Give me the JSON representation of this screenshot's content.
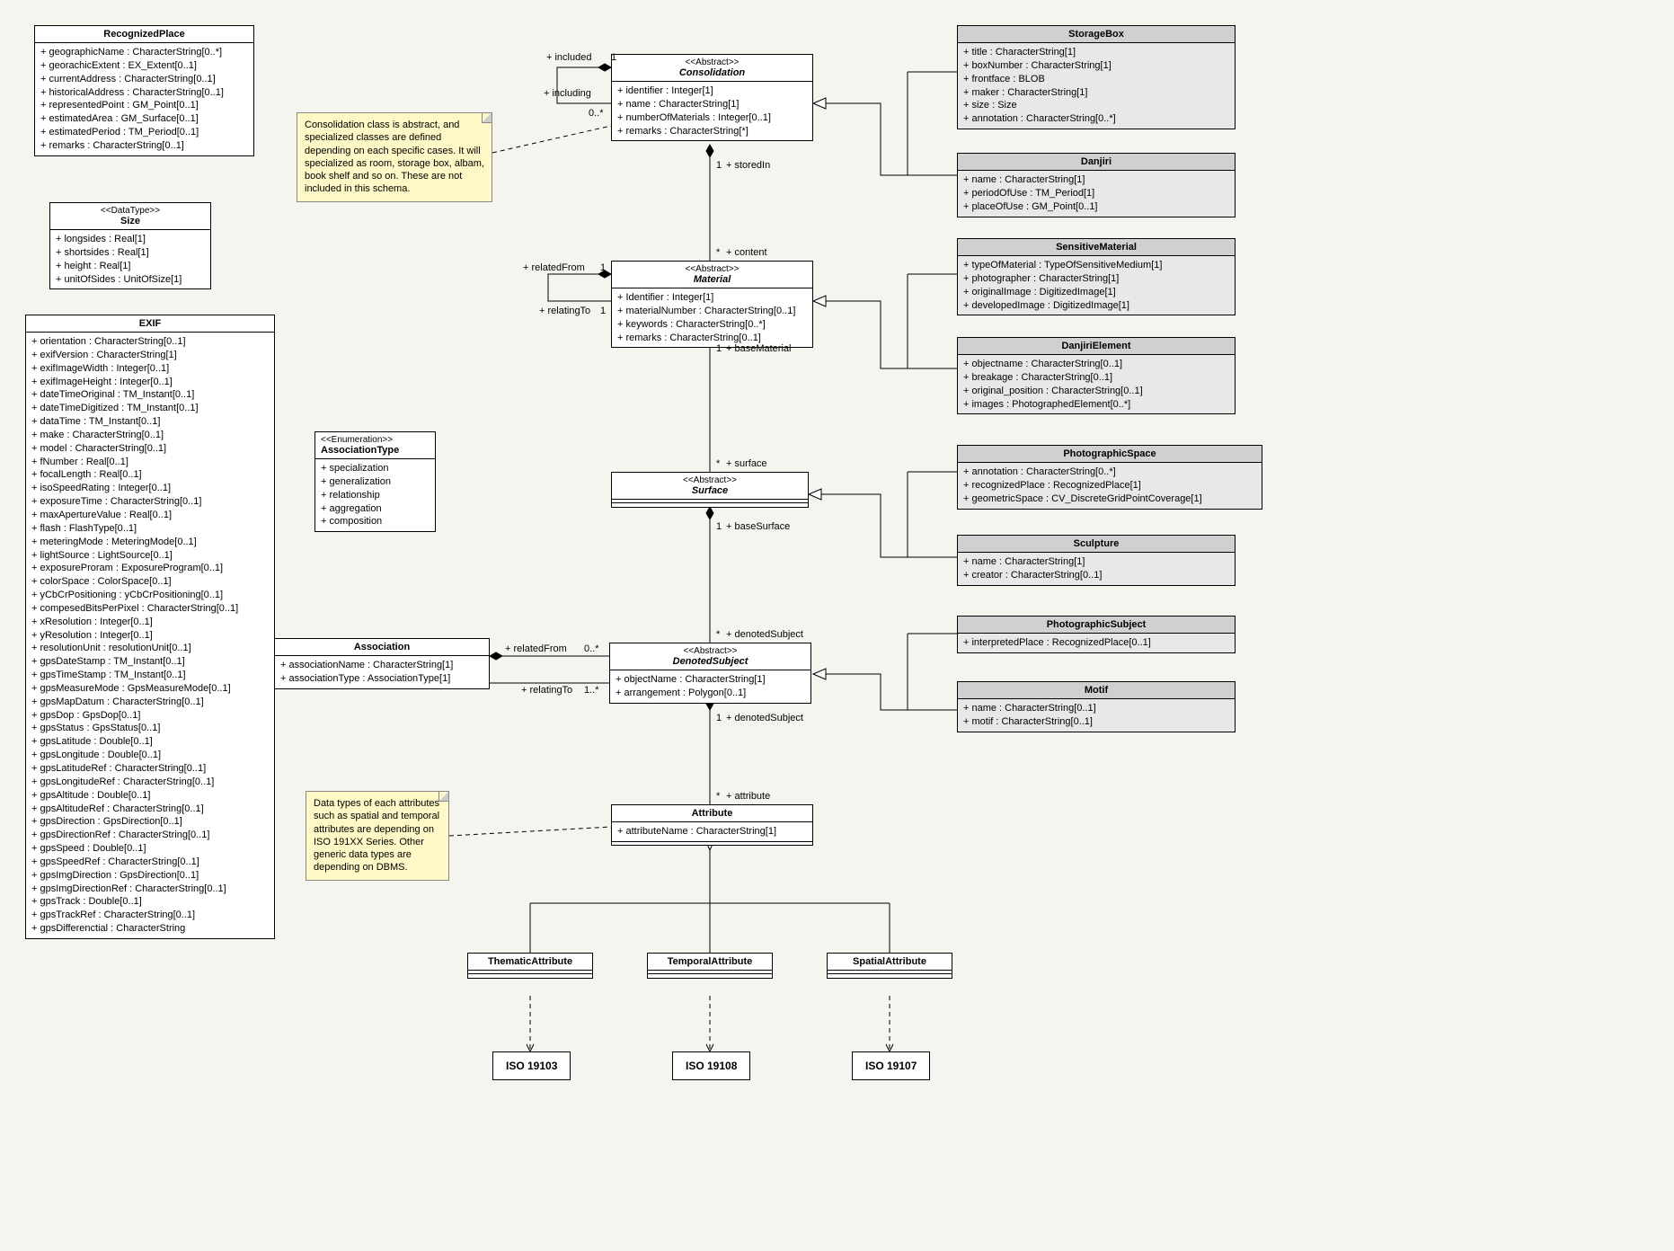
{
  "classes": {
    "RecognizedPlace": {
      "title": "RecognizedPlace",
      "attrs": [
        "+ geographicName : CharacterString[0..*]",
        "+ georachicExtent : EX_Extent[0..1]",
        "+ currentAddress : CharacterString[0..1]",
        "+ historicalAddress : CharacterString[0..1]",
        "+ representedPoint : GM_Point[0..1]",
        "+ estimatedArea : GM_Surface[0..1]",
        "+ estimatedPeriod : TM_Period[0..1]",
        "+ remarks : CharacterString[0..1]"
      ]
    },
    "Size": {
      "stereo": "<<DataType>>",
      "title": "Size",
      "attrs": [
        "+ longsides : Real[1]",
        "+ shortsides : Real[1]",
        "+ height : Real[1]",
        "+ unitOfSides : UnitOfSize[1]"
      ]
    },
    "EXIF": {
      "title": "EXIF",
      "attrs": [
        "+ orientation : CharacterString[0..1]",
        "+ exifVersion : CharacterString[1]",
        "+ exifImageWidth : Integer[0..1]",
        "+ exifImageHeight : Integer[0..1]",
        "+ dateTimeOriginal : TM_Instant[0..1]",
        "+ dateTimeDigitized : TM_Instant[0..1]",
        "+ dataTime : TM_Instant[0..1]",
        "+ make : CharacterString[0..1]",
        "+ model : CharacterString[0..1]",
        "+ fNumber : Real[0..1]",
        "+ focalLength : Real[0..1]",
        "+ isoSpeedRating : Integer[0..1]",
        "+ exposureTime : CharacterString[0..1]",
        "+ maxApertureValue : Real[0..1]",
        "+ flash : FlashType[0..1]",
        "+ meteringMode : MeteringMode[0..1]",
        "+ lightSource : LightSource[0..1]",
        "+ exposureProram : ExposureProgram[0..1]",
        "+ colorSpace : ColorSpace[0..1]",
        "+ yCbCrPositioning : yCbCrPositioning[0..1]",
        "+ compesedBitsPerPixel : CharacterString[0..1]",
        "+ xResolution : Integer[0..1]",
        "+ yResolution : Integer[0..1]",
        "+ resolutionUnit : resolutionUnit[0..1]",
        "+ gpsDateStamp : TM_Instant[0..1]",
        "+ gpsTimeStamp : TM_Instant[0..1]",
        "+ gpsMeasureMode : GpsMeasureMode[0..1]",
        "+ gpsMapDatum : CharacterString[0..1]",
        "+ gpsDop : GpsDop[0..1]",
        "+ gpsStatus : GpsStatus[0..1]",
        "+ gpsLatitude : Double[0..1]",
        "+ gpsLongitude : Double[0..1]",
        "+ gpsLatitudeRef : CharacterString[0..1]",
        "+ gpsLongitudeRef : CharacterString[0..1]",
        "+ gpsAltitude : Double[0..1]",
        "+ gpsAltitudeRef : CharacterString[0..1]",
        "+ gpsDirection : GpsDirection[0..1]",
        "+ gpsDirectionRef : CharacterString[0..1]",
        "+ gpsSpeed : Double[0..1]",
        "+ gpsSpeedRef : CharacterString[0..1]",
        "+ gpsImgDirection : GpsDirection[0..1]",
        "+ gpsImgDirectionRef : CharacterString[0..1]",
        "+ gpsTrack : Double[0..1]",
        "+ gpsTrackRef : CharacterString[0..1]",
        "+ gpsDifferenctial : CharacterString"
      ]
    },
    "Consolidation": {
      "stereo": "<<Abstract>>",
      "title": "Consolidation",
      "italic": true,
      "attrs": [
        "+ identifier : Integer[1]",
        "+ name : CharacterString[1]",
        "+ numberOfMaterials : Integer[0..1]",
        "+ remarks : CharacterString[*]"
      ]
    },
    "Material": {
      "stereo": "<<Abstract>>",
      "title": "Material",
      "italic": true,
      "attrs": [
        "+ Identifier : Integer[1]",
        "+ materialNumber : CharacterString[0..1]",
        "+ keywords : CharacterString[0..*]",
        "+ remarks : CharacterString[0..1]"
      ]
    },
    "AssociationType": {
      "stereo": "<<Enumeration>>",
      "title": "AssociationType",
      "attrs": [
        "+ specialization",
        "+ generalization",
        "+ relationship",
        "+ aggregation",
        "+ composition"
      ]
    },
    "Surface": {
      "stereo": "<<Abstract>>",
      "title": "Surface",
      "italic": true,
      "attrs": []
    },
    "Association": {
      "title": "Association",
      "attrs": [
        "+ associationName : CharacterString[1]",
        "+ associationType : AssociationType[1]"
      ]
    },
    "DenotedSubject": {
      "stereo": "<<Abstract>>",
      "title": "DenotedSubject",
      "italic": true,
      "attrs": [
        "+ objectName : CharacterString[1]",
        "+ arrangement : Polygon[0..1]"
      ]
    },
    "Attribute": {
      "title": "Attribute",
      "attrs": [
        "+ attributeName : CharacterString[1]"
      ]
    },
    "ThematicAttribute": {
      "title": "ThematicAttribute",
      "attrs": []
    },
    "TemporalAttribute": {
      "title": "TemporalAttribute",
      "attrs": []
    },
    "SpatialAttribute": {
      "title": "SpatialAttribute",
      "attrs": []
    },
    "StorageBox": {
      "title": "StorageBox",
      "attrs": [
        "+ title : CharacterString[1]",
        "+ boxNumber : CharacterString[1]",
        "+ frontface : BLOB",
        "+ maker : CharacterString[1]",
        "+ size : Size",
        "+ annotation : CharacterString[0..*]"
      ]
    },
    "Danjiri": {
      "title": "Danjiri",
      "attrs": [
        "+ name : CharacterString[1]",
        "+ periodOfUse : TM_Period[1]",
        "+ placeOfUse : GM_Point[0..1]"
      ]
    },
    "SensitiveMaterial": {
      "title": "SensitiveMaterial",
      "attrs": [
        "+ typeOfMaterial : TypeOfSensitiveMedium[1]",
        "+ photographer : CharacterString[1]",
        "+ originalImage : DigitizedImage[1]",
        "+ developedImage : DigitizedImage[1]"
      ]
    },
    "DanjiriElement": {
      "title": "DanjiriElement",
      "attrs": [
        "+ objectname : CharacterString[0..1]",
        "+ breakage : CharacterString[0..1]",
        "+ original_position : CharacterString[0..1]",
        "+ images : PhotographedElement[0..*]"
      ]
    },
    "PhotographicSpace": {
      "title": "PhotographicSpace",
      "attrs": [
        "+ annotation : CharacterString[0..*]",
        "+ recognizedPlace : RecognizedPlace[1]",
        "+ geometricSpace : CV_DiscreteGridPointCoverage[1]"
      ]
    },
    "Sculpture": {
      "title": "Sculpture",
      "attrs": [
        "+ name : CharacterString[1]",
        "+ creator : CharacterString[0..1]"
      ]
    },
    "PhotographicSubject": {
      "title": "PhotographicSubject",
      "attrs": [
        "+ interpretedPlace : RecognizedPlace[0..1]"
      ]
    },
    "Motif": {
      "title": "Motif",
      "attrs": [
        "+ name : CharacterString[0..1]",
        "+ motif : CharacterString[0..1]"
      ]
    }
  },
  "notes": {
    "consolidation": "Consolidation class is abstract, and specialized classes are defined depending on each specific cases. It will specialized as room, storage box, albam, book shelf and so on. These are not included in this schema.",
    "attribute": "Data types of each attributes such as spatial and temporal attributes are depending on ISO 191XX Series. Other generic data types are depending on DBMS."
  },
  "labels": {
    "included": "+ included",
    "including": "+ including",
    "storedIn": "+ storedIn",
    "content": "+ content",
    "relatedFrom": "+ relatedFrom",
    "relatingTo": "+ relatingTo",
    "baseMaterial": "+ baseMaterial",
    "surface": "+ surface",
    "baseSurface": "+ baseSurface",
    "denotedSubject": "+ denotedSubject",
    "attribute": "+ attribute",
    "one": "1",
    "star": "*",
    "zeroStar": "0..*",
    "oneStar": "1..*"
  },
  "iso": {
    "iso19103": "ISO 19103",
    "iso19108": "ISO 19108",
    "iso19107": "ISO 19107"
  }
}
